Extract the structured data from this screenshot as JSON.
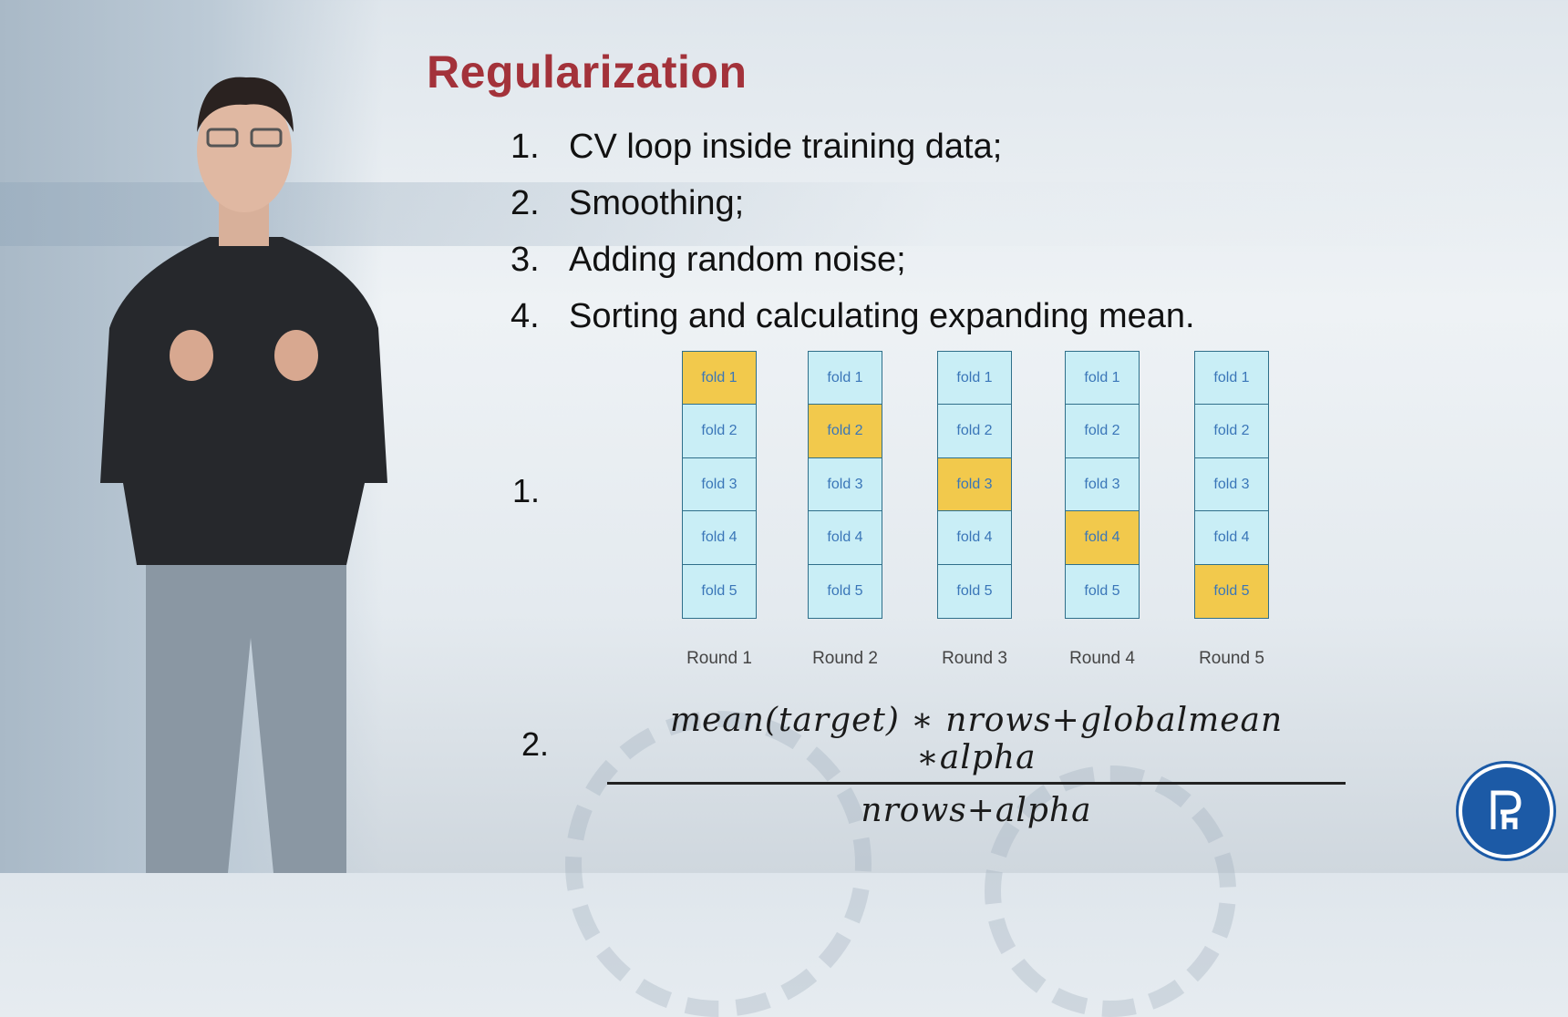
{
  "slide": {
    "title": "Regularization",
    "items": [
      {
        "num": "1.",
        "text": "CV loop inside training data;"
      },
      {
        "num": "2.",
        "text": "Smoothing;"
      },
      {
        "num": "3.",
        "text": "Adding random noise;"
      },
      {
        "num": "4.",
        "text": "Sorting and calculating expanding mean."
      }
    ],
    "section1_label": "1.",
    "section2_label": "2.",
    "folds_diagram": {
      "fold_labels": [
        "fold 1",
        "fold 2",
        "fold 3",
        "fold 4",
        "fold 5"
      ],
      "rounds": [
        {
          "label": "Round 1",
          "active_fold": 1
        },
        {
          "label": "Round 2",
          "active_fold": 2
        },
        {
          "label": "Round 3",
          "active_fold": 3
        },
        {
          "label": "Round 4",
          "active_fold": 4
        },
        {
          "label": "Round 5",
          "active_fold": 5
        }
      ],
      "colors": {
        "fold": "#c9eef6",
        "active": "#f2c94c",
        "border": "#2f6f8a",
        "text": "#3a76b8"
      }
    },
    "formula": {
      "numerator": "mean(target) ∗ nrows+globalmean ∗alpha",
      "denominator": "nrows+alpha"
    },
    "logo_icon": "hse-university-logo"
  },
  "colors": {
    "title": "#a3323a",
    "logo": "#1c5aa6"
  }
}
